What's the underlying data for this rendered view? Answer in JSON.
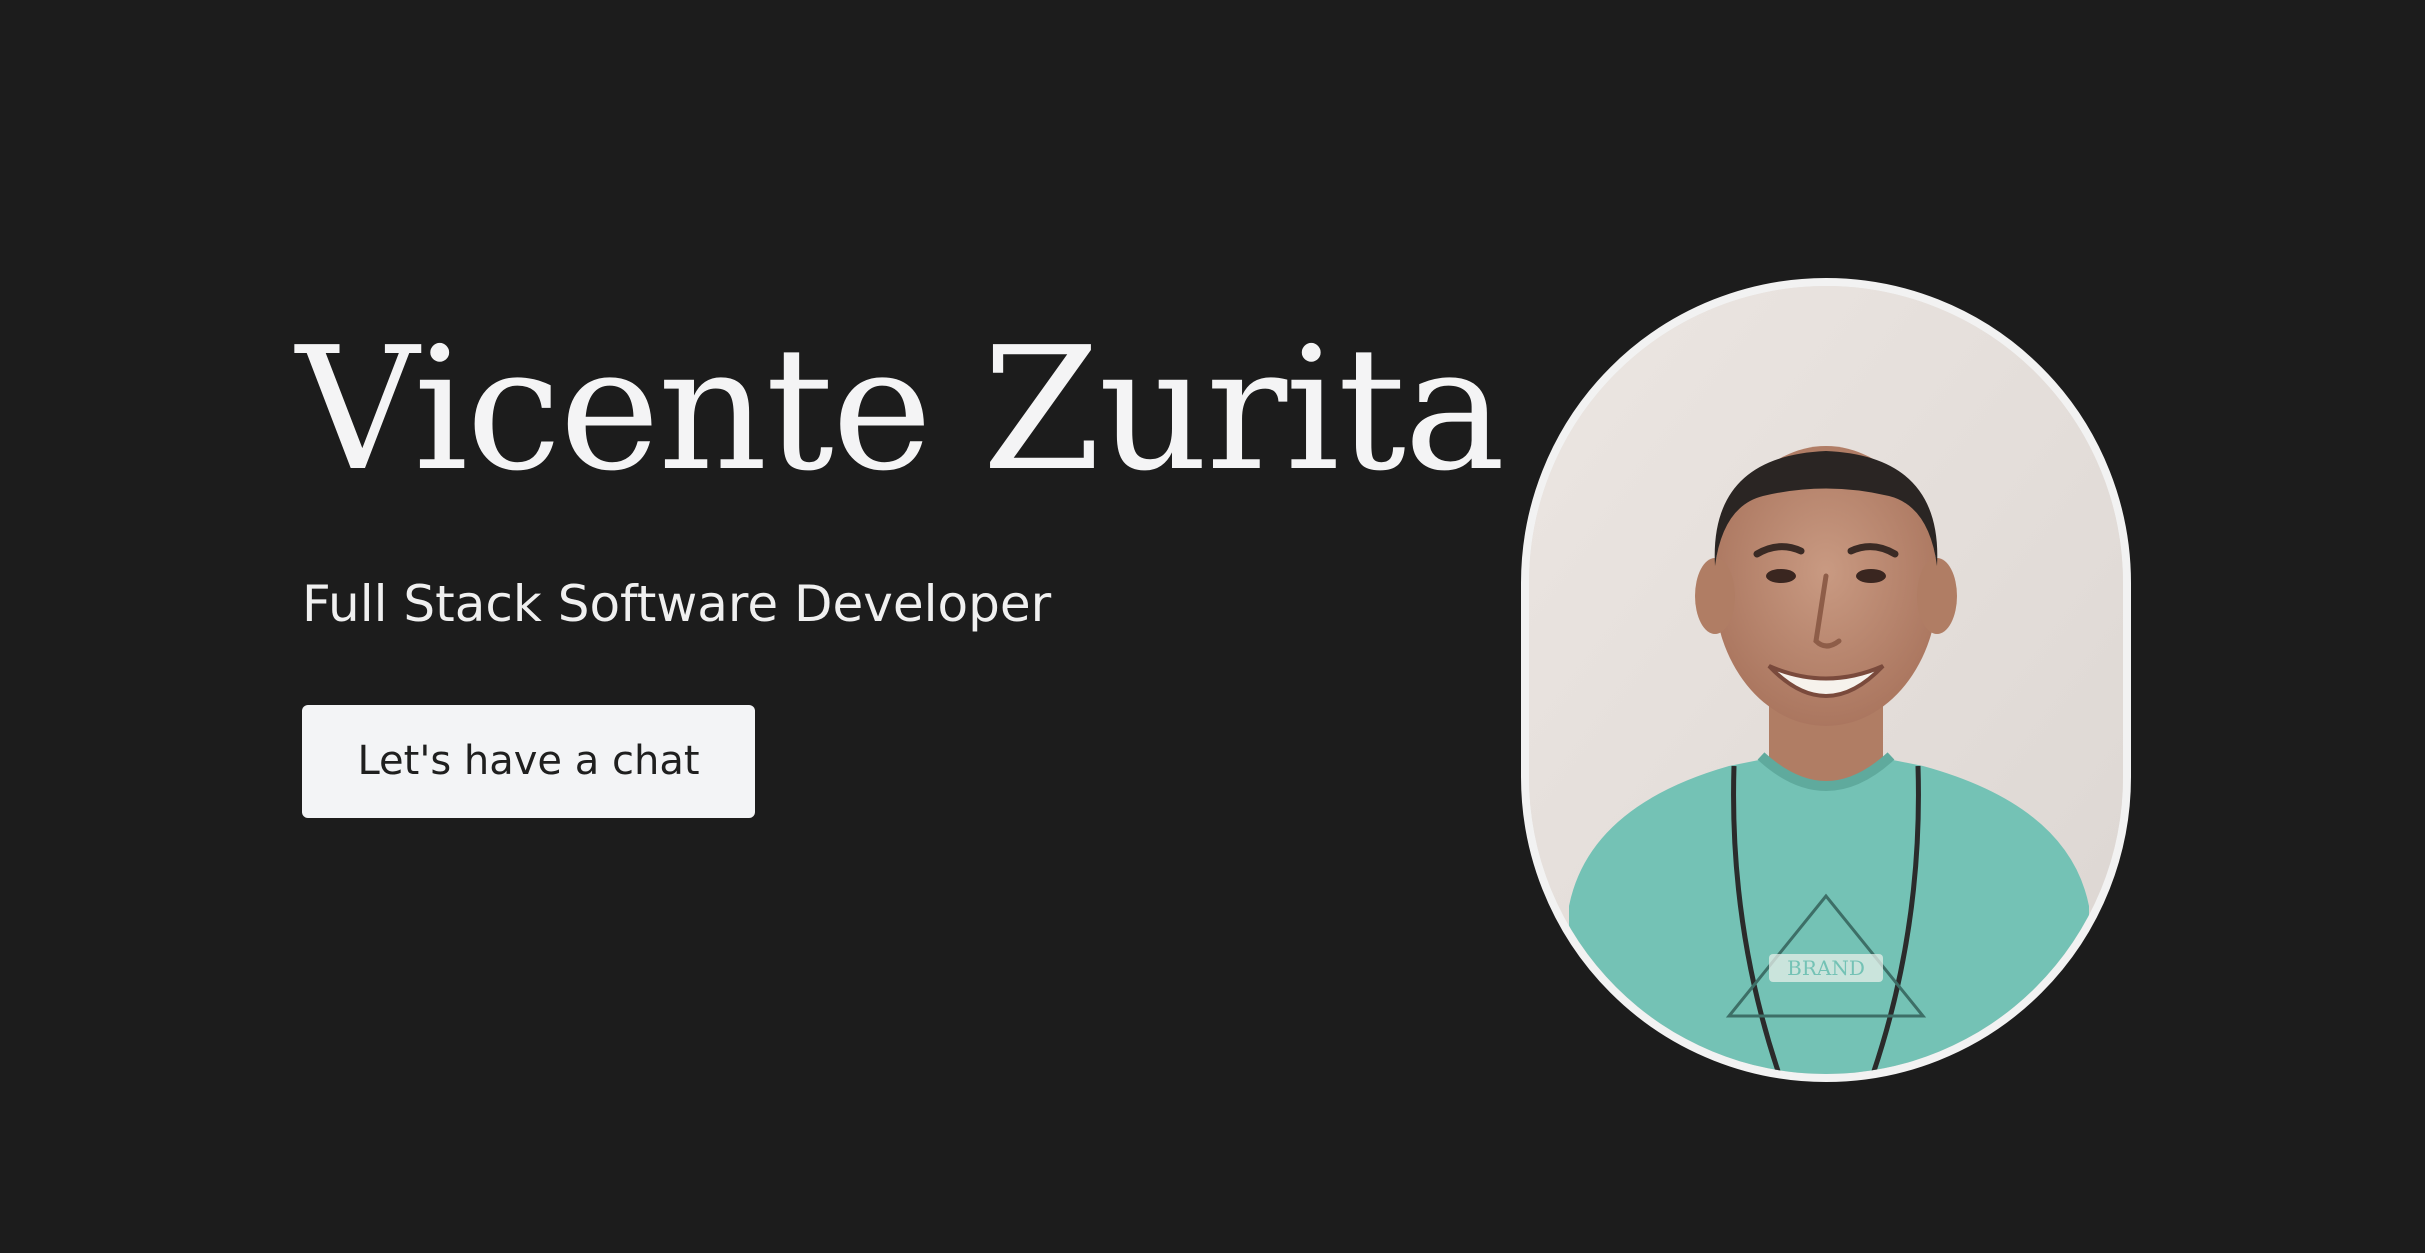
{
  "hero": {
    "name": "Vicente Zurita",
    "role": "Full Stack Software Developer",
    "cta_label": "Let's have a chat"
  },
  "portrait": {
    "subject": "smiling man in teal t-shirt with necklace",
    "shirt_print": "BRAND"
  },
  "colors": {
    "background": "#1c1c1c",
    "text": "#f4f4f5",
    "button_bg": "#f3f4f6",
    "button_text": "#1f1f1f",
    "frame_border": "#f2f2f2",
    "shirt": "#74c2b5"
  }
}
